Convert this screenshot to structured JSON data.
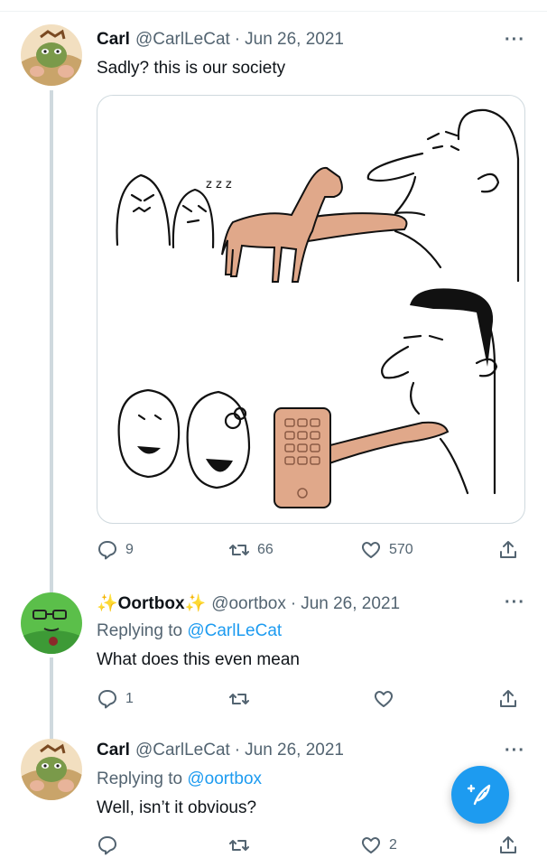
{
  "tweets": [
    {
      "name": "Carl",
      "handle": "@CarlLeCat",
      "separator": "·",
      "date": "Jun 26, 2021",
      "more": "···",
      "text": "Sadly? this is our society",
      "reply_count": "9",
      "retweet_count": "66",
      "like_count": "570"
    },
    {
      "name": "✨Oortbox✨",
      "handle": "@oortbox",
      "separator": "·",
      "date": "Jun 26, 2021",
      "more": "···",
      "replying_prefix": "Replying to",
      "replying_to": "@CarlLeCat",
      "text": "What does this even mean",
      "reply_count": "1",
      "retweet_count": "",
      "like_count": ""
    },
    {
      "name": "Carl",
      "handle": "@CarlLeCat",
      "separator": "·",
      "date": "Jun 26, 2021",
      "more": "···",
      "replying_prefix": "Replying to",
      "replying_to": "@oortbox",
      "text": "Well, isn’t it obvious?",
      "reply_count": "",
      "retweet_count": "",
      "like_count": "2"
    }
  ],
  "icons": {
    "reply": "reply-icon",
    "retweet": "retweet-icon",
    "like": "heart-icon",
    "share": "share-icon",
    "compose": "compose-tweet-icon"
  },
  "colors": {
    "accent": "#1d9bf0",
    "text": "#0f1419",
    "secondary": "#536471",
    "border": "#cfd9de",
    "horse": "#e0a88a"
  }
}
